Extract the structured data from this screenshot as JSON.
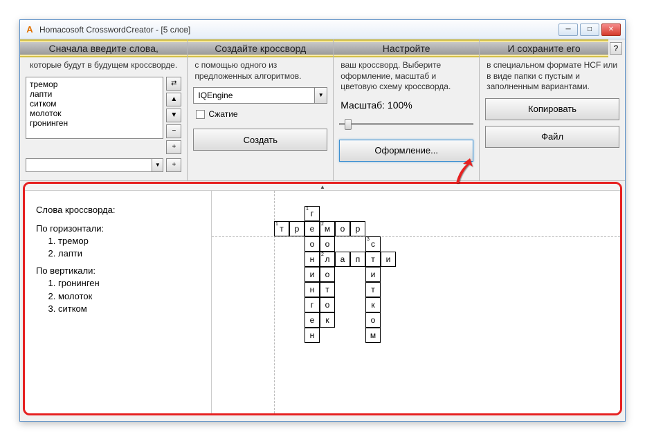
{
  "title": "Homacosoft CrosswordCreator - [5 слов]",
  "app_icon_letter": "A",
  "help_label": "?",
  "winbtns": {
    "min": "─",
    "max": "□",
    "close": "✕"
  },
  "sections": {
    "s1": {
      "header": "Сначала введите слова,",
      "desc": "которые будут в будущем кроссворде.",
      "words_text": "тремор\nлапти\nситком\nмолоток\nгронинген",
      "swap_glyph": "⇄",
      "up_glyph": "▲",
      "down_glyph": "▼",
      "minus_glyph": "−",
      "plus_glyph": "+",
      "combo_dd": "▼"
    },
    "s2": {
      "header": "Создайте кроссворд",
      "desc": "с помощью одного из предложенных алгоритмов.",
      "engine": "IQEngine",
      "compress": "Сжатие",
      "create": "Создать",
      "dd": "▼"
    },
    "s3": {
      "header": "Настройте",
      "desc": "ваш кроссворд. Выберите оформление, масштаб и цветовую схему кроссворда.",
      "scale": "Масштаб: 100%",
      "design": "Оформление..."
    },
    "s4": {
      "header": "И сохраните его",
      "desc": "в специальном формате HCF или в виде папки с пустым и заполненным вариантами.",
      "copy": "Копировать",
      "file": "Файл"
    }
  },
  "clues": {
    "title": "Слова кроссворда:",
    "across_title": "По горизонтали:",
    "across": [
      "тремор",
      "лапти"
    ],
    "down_title": "По вертикали:",
    "down": [
      "гронинген",
      "молоток",
      "ситком"
    ]
  },
  "grid": {
    "cell_size": 22,
    "cells": [
      {
        "r": 0,
        "c": 2,
        "ch": "г",
        "n": "1"
      },
      {
        "r": 1,
        "c": 0,
        "ch": "т",
        "n": "1"
      },
      {
        "r": 1,
        "c": 1,
        "ch": "р"
      },
      {
        "r": 1,
        "c": 2,
        "ch": "е"
      },
      {
        "r": 1,
        "c": 3,
        "ch": "м",
        "n": "2"
      },
      {
        "r": 1,
        "c": 4,
        "ch": "о"
      },
      {
        "r": 1,
        "c": 5,
        "ch": "р"
      },
      {
        "r": 2,
        "c": 2,
        "ch": "о"
      },
      {
        "r": 2,
        "c": 3,
        "ch": "о"
      },
      {
        "r": 2,
        "c": 6,
        "ch": "с",
        "n": "3"
      },
      {
        "r": 3,
        "c": 2,
        "ch": "н"
      },
      {
        "r": 3,
        "c": 3,
        "ch": "л",
        "n": "2"
      },
      {
        "r": 3,
        "c": 4,
        "ch": "а"
      },
      {
        "r": 3,
        "c": 5,
        "ch": "п"
      },
      {
        "r": 3,
        "c": 6,
        "ch": "т"
      },
      {
        "r": 3,
        "c": 7,
        "ch": "и"
      },
      {
        "r": 4,
        "c": 2,
        "ch": "и"
      },
      {
        "r": 4,
        "c": 3,
        "ch": "о"
      },
      {
        "r": 4,
        "c": 6,
        "ch": "и"
      },
      {
        "r": 5,
        "c": 2,
        "ch": "н"
      },
      {
        "r": 5,
        "c": 3,
        "ch": "т"
      },
      {
        "r": 5,
        "c": 6,
        "ch": "т"
      },
      {
        "r": 6,
        "c": 2,
        "ch": "г"
      },
      {
        "r": 6,
        "c": 3,
        "ch": "о"
      },
      {
        "r": 6,
        "c": 6,
        "ch": "к"
      },
      {
        "r": 7,
        "c": 2,
        "ch": "е"
      },
      {
        "r": 7,
        "c": 3,
        "ch": "к"
      },
      {
        "r": 7,
        "c": 6,
        "ch": "о"
      },
      {
        "r": 8,
        "c": 2,
        "ch": "н"
      },
      {
        "r": 8,
        "c": 6,
        "ch": "м"
      }
    ]
  }
}
